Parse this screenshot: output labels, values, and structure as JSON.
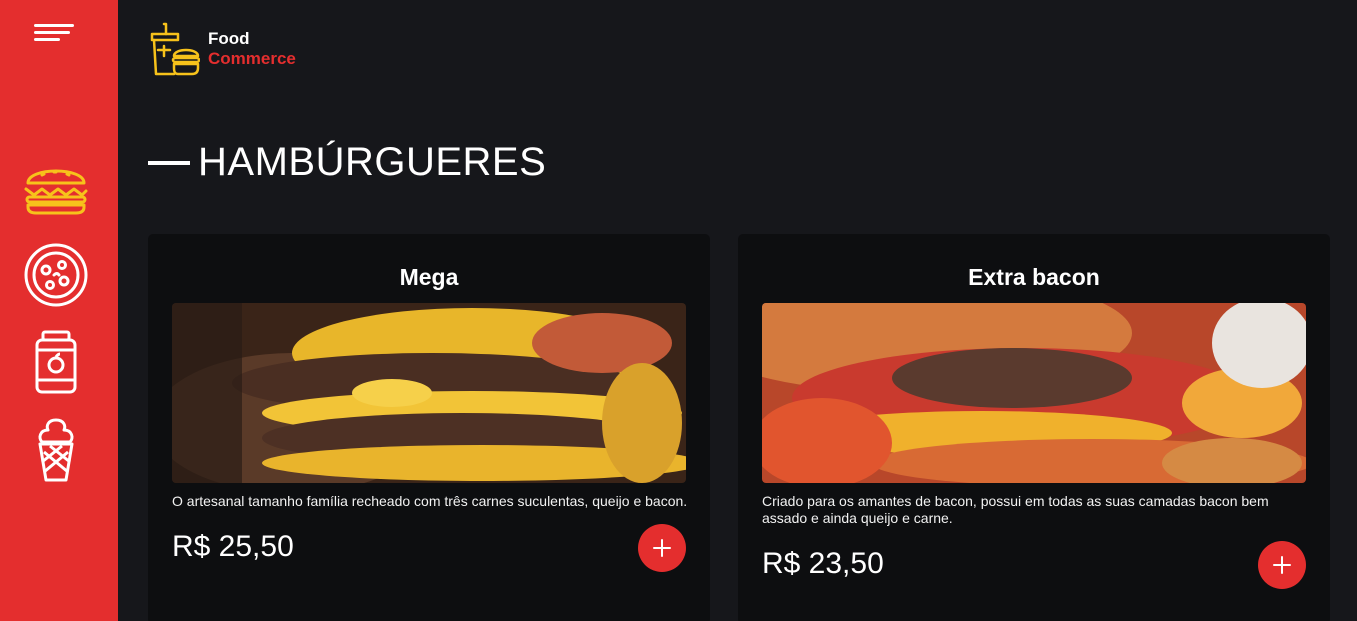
{
  "brand": {
    "line1": "Food",
    "line2": "Commerce"
  },
  "section": {
    "title": "HAMBÚRGUERES"
  },
  "sidebar": {
    "items": [
      {
        "icon": "burger-icon",
        "active": true
      },
      {
        "icon": "pizza-icon",
        "active": false
      },
      {
        "icon": "soda-can-icon",
        "active": false
      },
      {
        "icon": "ice-cream-icon",
        "active": false
      }
    ]
  },
  "products": [
    {
      "name": "Mega",
      "description": "O artesanal tamanho família recheado com três carnes suculentas, queijo e bacon.",
      "price": "R$ 25,50"
    },
    {
      "name": "Extra bacon",
      "description": "Criado para os amantes de bacon, possui em todas as suas camadas bacon bem assado e ainda queijo e carne.",
      "price": "R$ 23,50"
    }
  ],
  "colors": {
    "accent": "#e42e2e",
    "background": "#16171b",
    "card": "#0d0e10",
    "active_icon": "#f7c21b"
  }
}
